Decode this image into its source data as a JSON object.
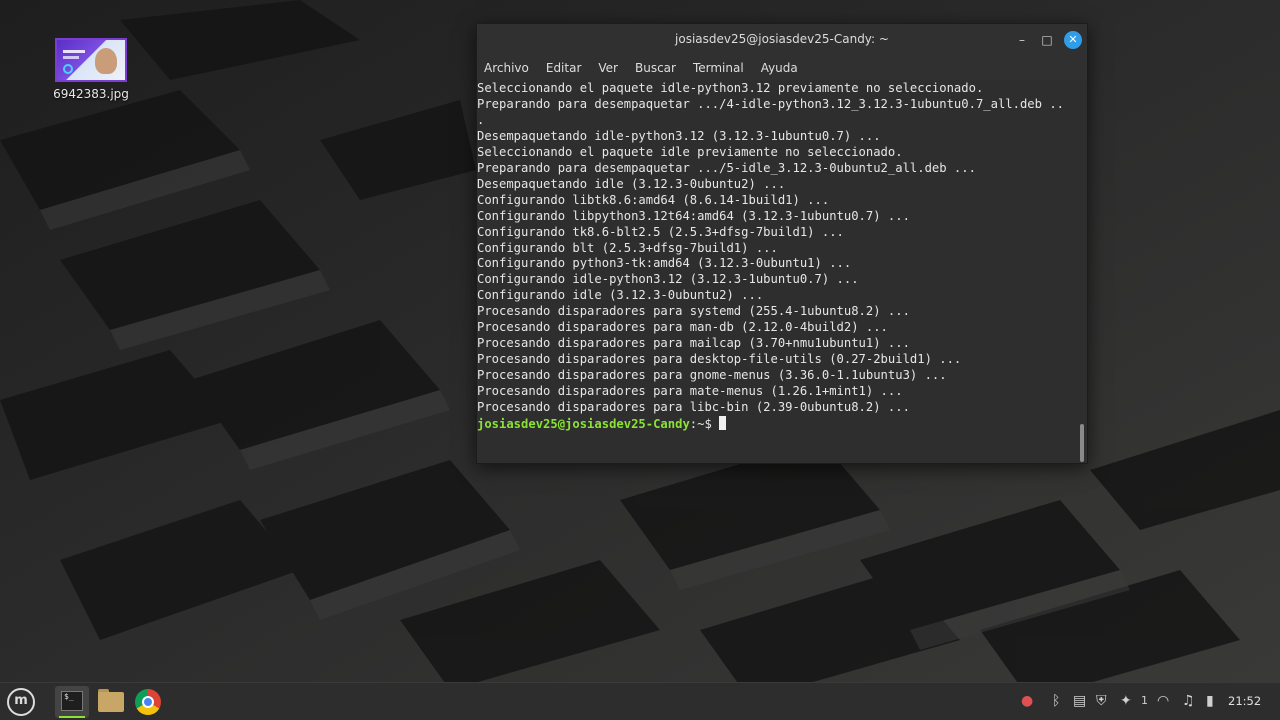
{
  "desktop": {
    "file": {
      "name": "6942383.jpg",
      "icon": "image-file-icon"
    }
  },
  "terminal": {
    "title": "josiasdev25@josiasdev25-Candy: ~",
    "controls": {
      "minimize": "–",
      "maximize": "□",
      "close": "✕"
    },
    "menu": [
      "Archivo",
      "Editar",
      "Ver",
      "Buscar",
      "Terminal",
      "Ayuda"
    ],
    "output_lines": [
      "Seleccionando el paquete idle-python3.12 previamente no seleccionado.",
      "Preparando para desempaquetar .../4-idle-python3.12_3.12.3-1ubuntu0.7_all.deb ..",
      ".",
      "Desempaquetando idle-python3.12 (3.12.3-1ubuntu0.7) ...",
      "Seleccionando el paquete idle previamente no seleccionado.",
      "Preparando para desempaquetar .../5-idle_3.12.3-0ubuntu2_all.deb ...",
      "Desempaquetando idle (3.12.3-0ubuntu2) ...",
      "Configurando libtk8.6:amd64 (8.6.14-1build1) ...",
      "Configurando libpython3.12t64:amd64 (3.12.3-1ubuntu0.7) ...",
      "Configurando tk8.6-blt2.5 (2.5.3+dfsg-7build1) ...",
      "Configurando blt (2.5.3+dfsg-7build1) ...",
      "Configurando python3-tk:amd64 (3.12.3-0ubuntu1) ...",
      "Configurando idle-python3.12 (3.12.3-1ubuntu0.7) ...",
      "Configurando idle (3.12.3-0ubuntu2) ...",
      "Procesando disparadores para systemd (255.4-1ubuntu8.2) ...",
      "Procesando disparadores para man-db (2.12.0-4build2) ...",
      "Procesando disparadores para mailcap (3.70+nmu1ubuntu1) ...",
      "Procesando disparadores para desktop-file-utils (0.27-2build1) ...",
      "Procesando disparadores para gnome-menus (3.36.0-1.1ubuntu3) ...",
      "Procesando disparadores para mate-menus (1.26.1+mint1) ...",
      "Procesando disparadores para libc-bin (2.39-0ubuntu8.2) ..."
    ],
    "prompt": {
      "user_host": "josiasdev25@josiasdev25-Candy",
      "path": ":~$ "
    }
  },
  "taskbar": {
    "launchers": [
      "mint-menu-icon",
      "terminal-icon",
      "folder-icon",
      "browser-icon"
    ],
    "tray": {
      "camera_icon": "●",
      "bluetooth_icon": "ᛒ",
      "clipboard_icon": "▤",
      "shield_icon": "⛨",
      "notification_icon": "✦",
      "notification_count": "1",
      "wifi_icon": "◠",
      "music_icon": "♫",
      "battery_icon": "▮"
    },
    "clock": "21:52"
  },
  "colors": {
    "prompt_user": "#8ae234",
    "close_button": "#2f9de8",
    "terminal_bg": "#2e2e2e"
  }
}
